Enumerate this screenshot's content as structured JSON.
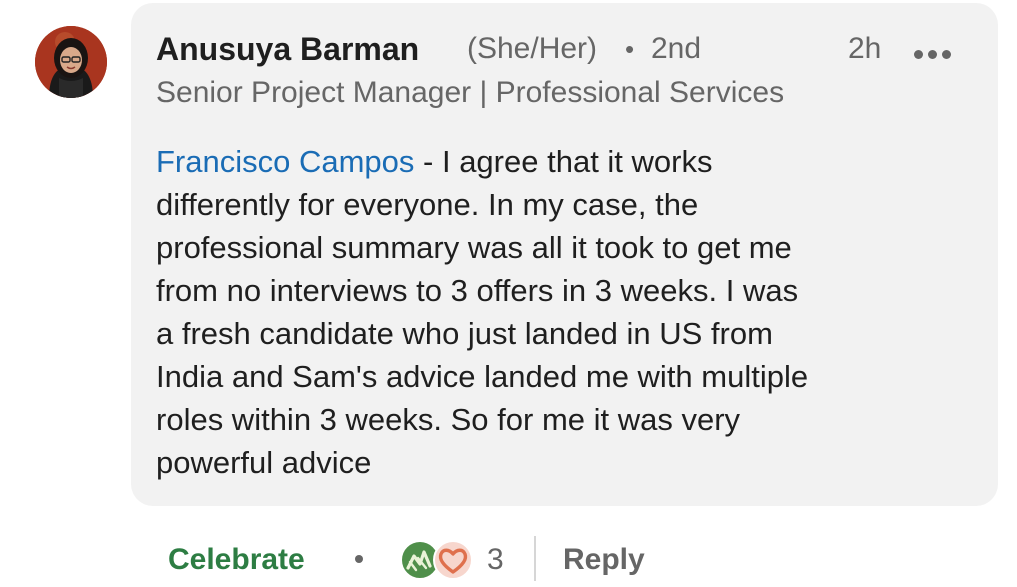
{
  "comment": {
    "author": {
      "name": "Anusuya Barman",
      "pronouns": "(She/Her)",
      "separator": "•",
      "degree": "2nd",
      "headline": "Senior Project Manager | Professional Services",
      "avatar_icon": "profile-photo"
    },
    "time": "2h",
    "more_icon": "more-horizontal-icon",
    "mention": "Francisco Campos",
    "body_lines": [
      " - I agree that it works",
      "differently for everyone. In my case, the",
      "professional summary was all it took to get me",
      "from no interviews to 3 offers in 3 weeks. I was",
      "a fresh candidate who just landed in US from",
      "India and Sam's advice landed me with multiple",
      "roles within 3 weeks. So for me it was very",
      "powerful advice"
    ]
  },
  "actions": {
    "reaction_label": "Celebrate",
    "separator": "•",
    "reaction_icons": [
      "celebrate-icon",
      "love-icon"
    ],
    "reaction_count": "3",
    "reply_label": "Reply"
  },
  "colors": {
    "bubble_bg": "#f2f2f2",
    "mention": "#1a6cb5",
    "celebrate": "#2d7d43",
    "love": "#df704d",
    "muted_text": "#666666"
  }
}
